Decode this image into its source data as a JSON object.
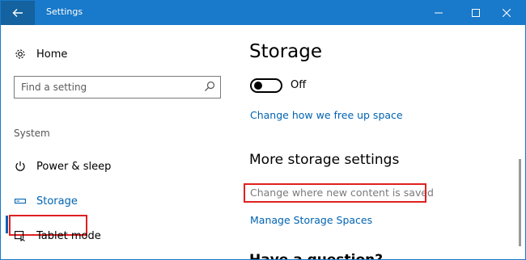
{
  "window": {
    "title": "Settings"
  },
  "sidebar": {
    "home_label": "Home",
    "search_placeholder": "Find a setting",
    "section_label": "System",
    "items": [
      {
        "label": "Power & sleep",
        "icon": "power-icon"
      },
      {
        "label": "Storage",
        "icon": "storage-icon",
        "selected": true
      },
      {
        "label": "Tablet mode",
        "icon": "tablet-mode-icon"
      }
    ]
  },
  "content": {
    "title": "Storage",
    "storage_sense_toggle": {
      "state_label": "Off",
      "on": false
    },
    "free_up_link": "Change how we free up space",
    "more_heading": "More storage settings",
    "change_saved_link": "Change where new content is saved",
    "manage_spaces_link": "Manage Storage Spaces",
    "partial_heading": "Have a question?"
  },
  "colors": {
    "titlebar": "#1979ca",
    "accent": "#0063b1",
    "highlight_box": "#e02020"
  }
}
